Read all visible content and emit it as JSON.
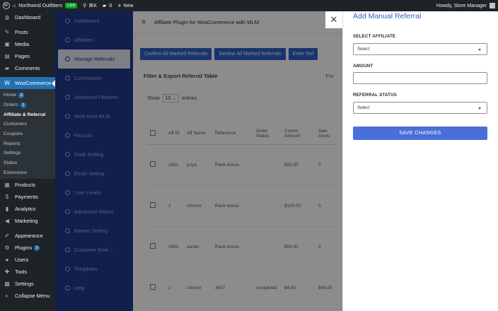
{
  "topbar": {
    "site_name": "Northwind Outfitters",
    "live_badge": "Live",
    "shortcut": "⌘K",
    "comments_count": "0",
    "new_label": "New",
    "greeting": "Howdy, Store Manager"
  },
  "sidebar": {
    "items_top": [
      {
        "label": "Dashboard",
        "icon": "dashboard-icon",
        "glyph": "◍"
      },
      {
        "label": "Posts",
        "icon": "pin-icon",
        "glyph": "✎"
      },
      {
        "label": "Media",
        "icon": "media-icon",
        "glyph": "▣"
      },
      {
        "label": "Pages",
        "icon": "pages-icon",
        "glyph": "▤"
      },
      {
        "label": "Comments",
        "icon": "comments-icon",
        "glyph": "▰"
      }
    ],
    "woocommerce": {
      "label": "WooCommerce",
      "glyph": "W"
    },
    "submenu": [
      {
        "label": "Home",
        "badge": "3"
      },
      {
        "label": "Orders",
        "badge": "1"
      },
      {
        "label": "Affiliate & Referral",
        "badge": ""
      },
      {
        "label": "Customers",
        "badge": ""
      },
      {
        "label": "Coupons",
        "badge": ""
      },
      {
        "label": "Reports",
        "badge": ""
      },
      {
        "label": "Settings",
        "badge": ""
      },
      {
        "label": "Status",
        "badge": ""
      },
      {
        "label": "Extensions",
        "badge": ""
      }
    ],
    "items_bottom": [
      {
        "label": "Products",
        "glyph": "▦",
        "badge": ""
      },
      {
        "label": "Payments",
        "glyph": "$",
        "badge": ""
      },
      {
        "label": "Analytics",
        "glyph": "▮",
        "badge": ""
      },
      {
        "label": "Marketing",
        "glyph": "◀",
        "badge": ""
      },
      {
        "label": "Appearance",
        "glyph": "✐",
        "badge": ""
      },
      {
        "label": "Plugins",
        "glyph": "⚙",
        "badge": "2"
      },
      {
        "label": "Users",
        "glyph": "●",
        "badge": ""
      },
      {
        "label": "Tools",
        "glyph": "✚",
        "badge": ""
      },
      {
        "label": "Settings",
        "glyph": "▩",
        "badge": ""
      },
      {
        "label": "Collapse Menu",
        "glyph": "◐",
        "badge": ""
      }
    ]
  },
  "plugin_nav": [
    "Dashboard",
    "Affiliates",
    "Manage Referrals",
    "Commission",
    "Advanced Features",
    "Multi-level MLM",
    "Payouts",
    "Rank Setting",
    "Email Setting",
    "User Levels",
    "Advanced Report",
    "Banner Setting",
    "Customer Rele...",
    "Templates",
    "Help"
  ],
  "main": {
    "title": "Affiliate Plugin for WooCommerce with MLM",
    "buttons": [
      "Confirm All Marked Referrals",
      "Decline All Marked Referrals",
      "Enter Ref"
    ],
    "filter_title": "Filter & Export Referral Table",
    "filter_right": "Fro",
    "show_label": "Show",
    "show_value": "10",
    "entries_label": "entries",
    "columns": [
      "",
      "Aff ID",
      "Aff Name",
      "Reference",
      "Order Status",
      "Comm. Amount",
      "Sale Amou"
    ],
    "rows": [
      [
        "1681",
        "priya",
        "Rank bonus",
        "",
        "$50.00",
        "0"
      ],
      [
        "2",
        "referrer",
        "Rank bonus",
        "",
        "$100.00",
        "0"
      ],
      [
        "1680",
        "daniel",
        "Rank bonus",
        "",
        "$50.00",
        "0"
      ],
      [
        "2",
        "referrer",
        "3607",
        "completed",
        "$4.80",
        "$48.00"
      ]
    ]
  },
  "panel": {
    "title": "Add Manual Referral",
    "affiliate_label": "SELECT AFFILIATE",
    "affiliate_value": "Select",
    "amount_label": "AMOUNT",
    "amount_value": "",
    "status_label": "REFERRAL STATUS",
    "status_value": "Select",
    "save_label": "SAVE CHANGES",
    "close_glyph": "✕"
  }
}
